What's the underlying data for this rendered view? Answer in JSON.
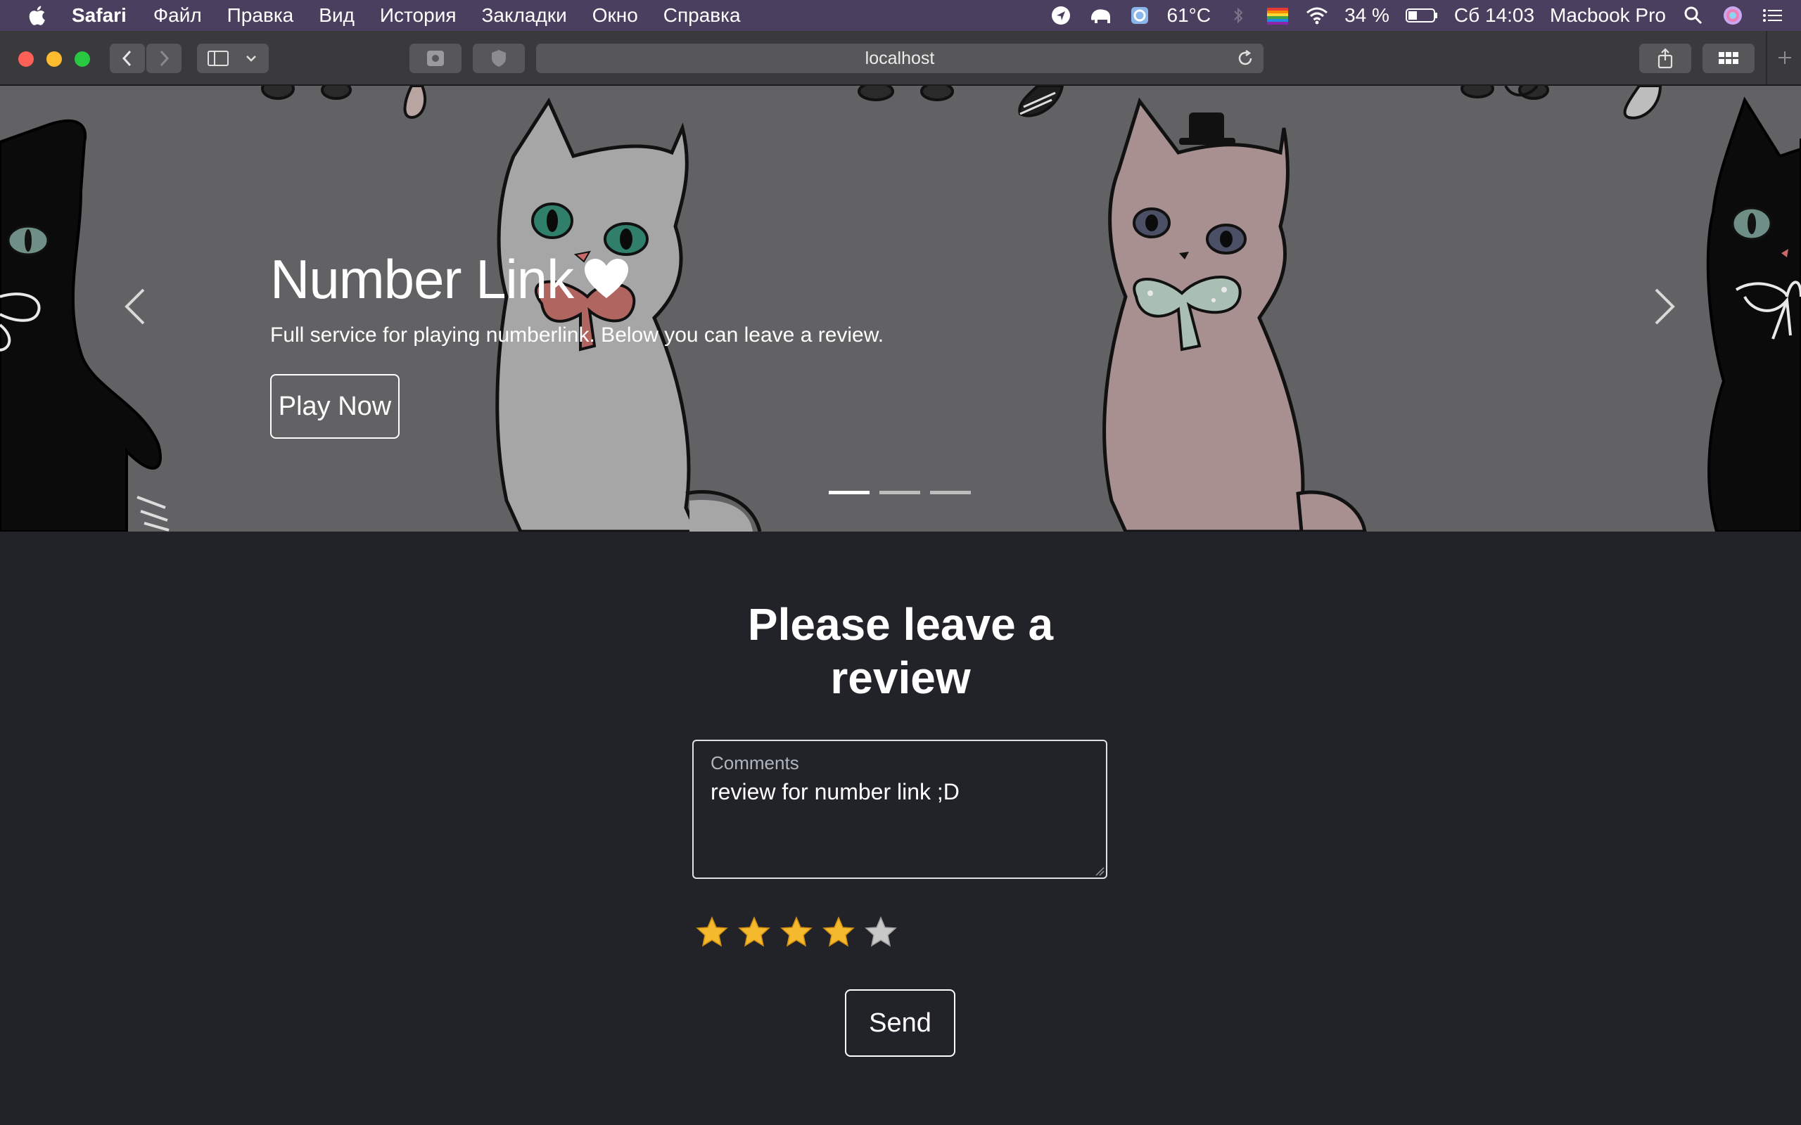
{
  "menubar": {
    "app_name": "Safari",
    "items": [
      "Файл",
      "Правка",
      "Вид",
      "История",
      "Закладки",
      "Окно",
      "Справка"
    ],
    "temperature": "61°C",
    "battery": "34 %",
    "datetime": "Сб 14:03",
    "device_name": "Macbook Pro"
  },
  "browser": {
    "url": "localhost"
  },
  "hero": {
    "title": "Number Link",
    "subtitle": "Full service for playing numberlink. Below you can leave a review.",
    "play_label": "Play Now",
    "active_slide": 1,
    "slide_count": 3
  },
  "review": {
    "title_line1": "Please leave a",
    "title_line2": "review",
    "comment_label": "Comments",
    "comment_value": "review for number link ;D",
    "rating": 4,
    "max_rating": 5,
    "send_label": "Send"
  },
  "colors": {
    "menubar_bg": "#4a3f5e",
    "page_bg": "#212329",
    "hero_bg": "#626264",
    "star_filled": "#f4b92c",
    "star_empty": "#c8c8c8"
  }
}
